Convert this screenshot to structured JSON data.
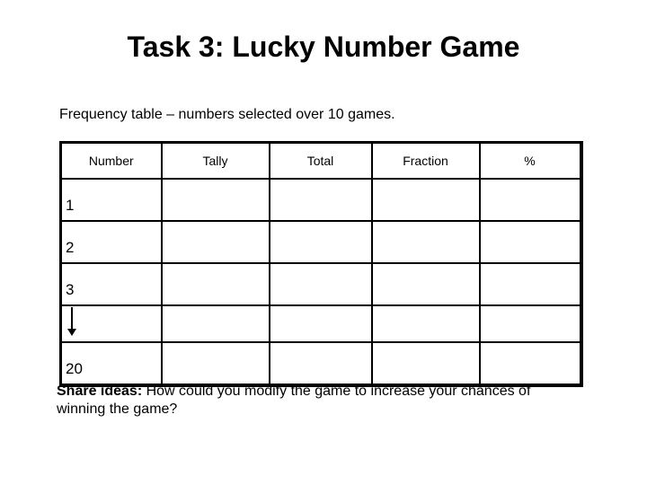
{
  "title": "Task 3: Lucky Number Game",
  "subtitle": "Frequency table – numbers selected over 10 games.",
  "table": {
    "headers": [
      "Number",
      "Tally",
      "Total",
      "Fraction",
      "%"
    ],
    "rows": [
      {
        "number": "1"
      },
      {
        "number": "2"
      },
      {
        "number": "3"
      },
      {
        "number": "",
        "icon": "down-arrow-icon"
      },
      {
        "number": "20"
      }
    ]
  },
  "share": {
    "label": "Share ideas:",
    "text": " How could you modify the game to increase your chances of winning the game?"
  }
}
